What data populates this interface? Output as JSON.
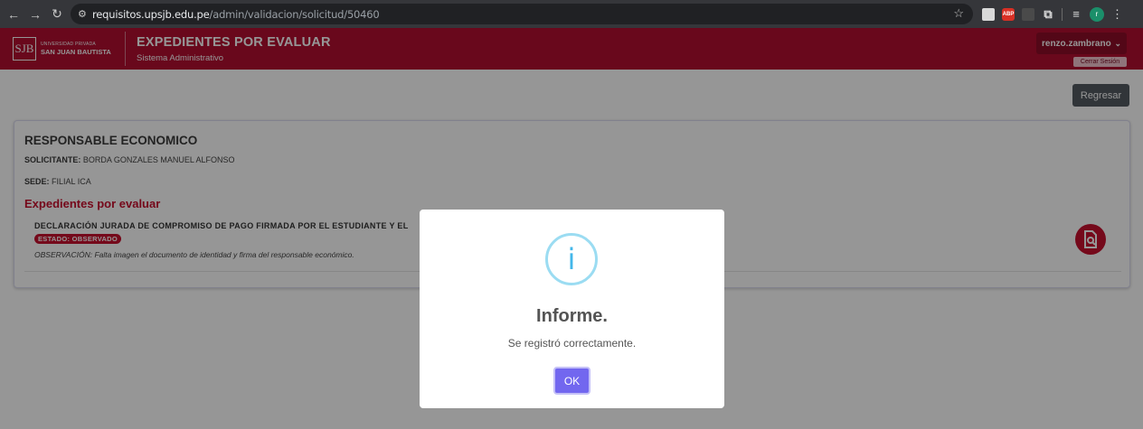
{
  "browser": {
    "url_host": "requisitos.upsjb.edu.pe",
    "url_path": "/admin/validacion/solicitud/50460",
    "nav_icons": [
      "back-arrow-icon",
      "forward-arrow-icon",
      "reload-icon"
    ],
    "site_icon": "tune-icon",
    "bookmark_icon": "star-icon",
    "extensions": {
      "e1": "",
      "e2": "ABP",
      "e3": "",
      "e4": "puzzle-icon"
    },
    "profile_initial": "r",
    "menu_icon": "kebab-menu-icon"
  },
  "app": {
    "logo_mark": "SJB",
    "logo_line1": "UNIVERSIDAD PRIVADA",
    "logo_line2": "SAN JUAN BAUTISTA",
    "title": "EXPEDIENTES POR EVALUAR",
    "subtitle": "Sistema Administrativo",
    "user_name": "renzo.zambrano",
    "user_menu_chevron": "⌄",
    "logout_label": "Cerrar Sesión",
    "brand_color": "#b30f31"
  },
  "main": {
    "back_label": "Regresar",
    "card": {
      "title": "RESPONSABLE ECONOMICO",
      "solicitante_label": "SOLICITANTE:",
      "solicitante_value": "BORDA GONZALES MANUEL ALFONSO",
      "sede_label": "SEDE:",
      "sede_value": "FILIAL ICA",
      "section_title": "Expedientes por evaluar",
      "document": {
        "title": "DECLARACIÓN JURADA DE COMPROMISO DE PAGO FIRMADA POR EL ESTUDIANTE Y EL",
        "status": "ESTADO: OBSERVADO",
        "observation": "OBSERVACIÓN: Falta imagen el documento de identidad y firma del responsable económico.",
        "view_icon": "document-search-icon"
      }
    }
  },
  "modal": {
    "icon_glyph": "i",
    "icon_name": "info-icon",
    "title": "Informe.",
    "text": "Se registró correctamente.",
    "ok_label": "OK"
  }
}
